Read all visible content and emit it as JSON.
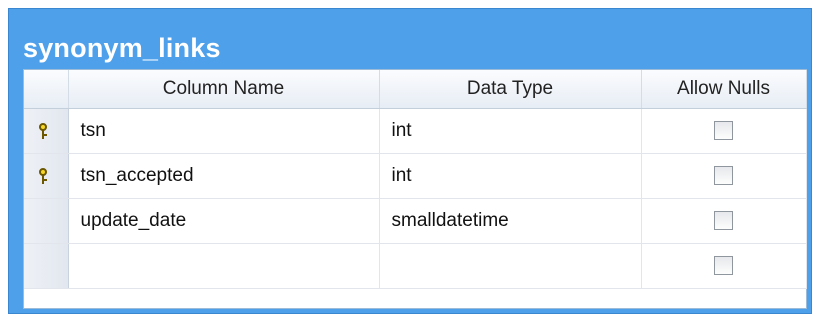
{
  "table": {
    "name": "synonym_links",
    "headers": {
      "column_name": "Column Name",
      "data_type": "Data Type",
      "allow_nulls": "Allow Nulls"
    },
    "rows": [
      {
        "column_name": "tsn",
        "data_type": "int",
        "primary_key": true,
        "allow_nulls": false
      },
      {
        "column_name": "tsn_accepted",
        "data_type": "int",
        "primary_key": true,
        "allow_nulls": false
      },
      {
        "column_name": "update_date",
        "data_type": "smalldatetime",
        "primary_key": false,
        "allow_nulls": false
      },
      {
        "column_name": "",
        "data_type": "",
        "primary_key": false,
        "allow_nulls": false
      }
    ]
  },
  "icons": {
    "primary_key": "key-icon",
    "checkbox": "checkbox-unchecked"
  },
  "colors": {
    "title_bar": "#4ea0eb",
    "title_text": "#ffffff"
  }
}
